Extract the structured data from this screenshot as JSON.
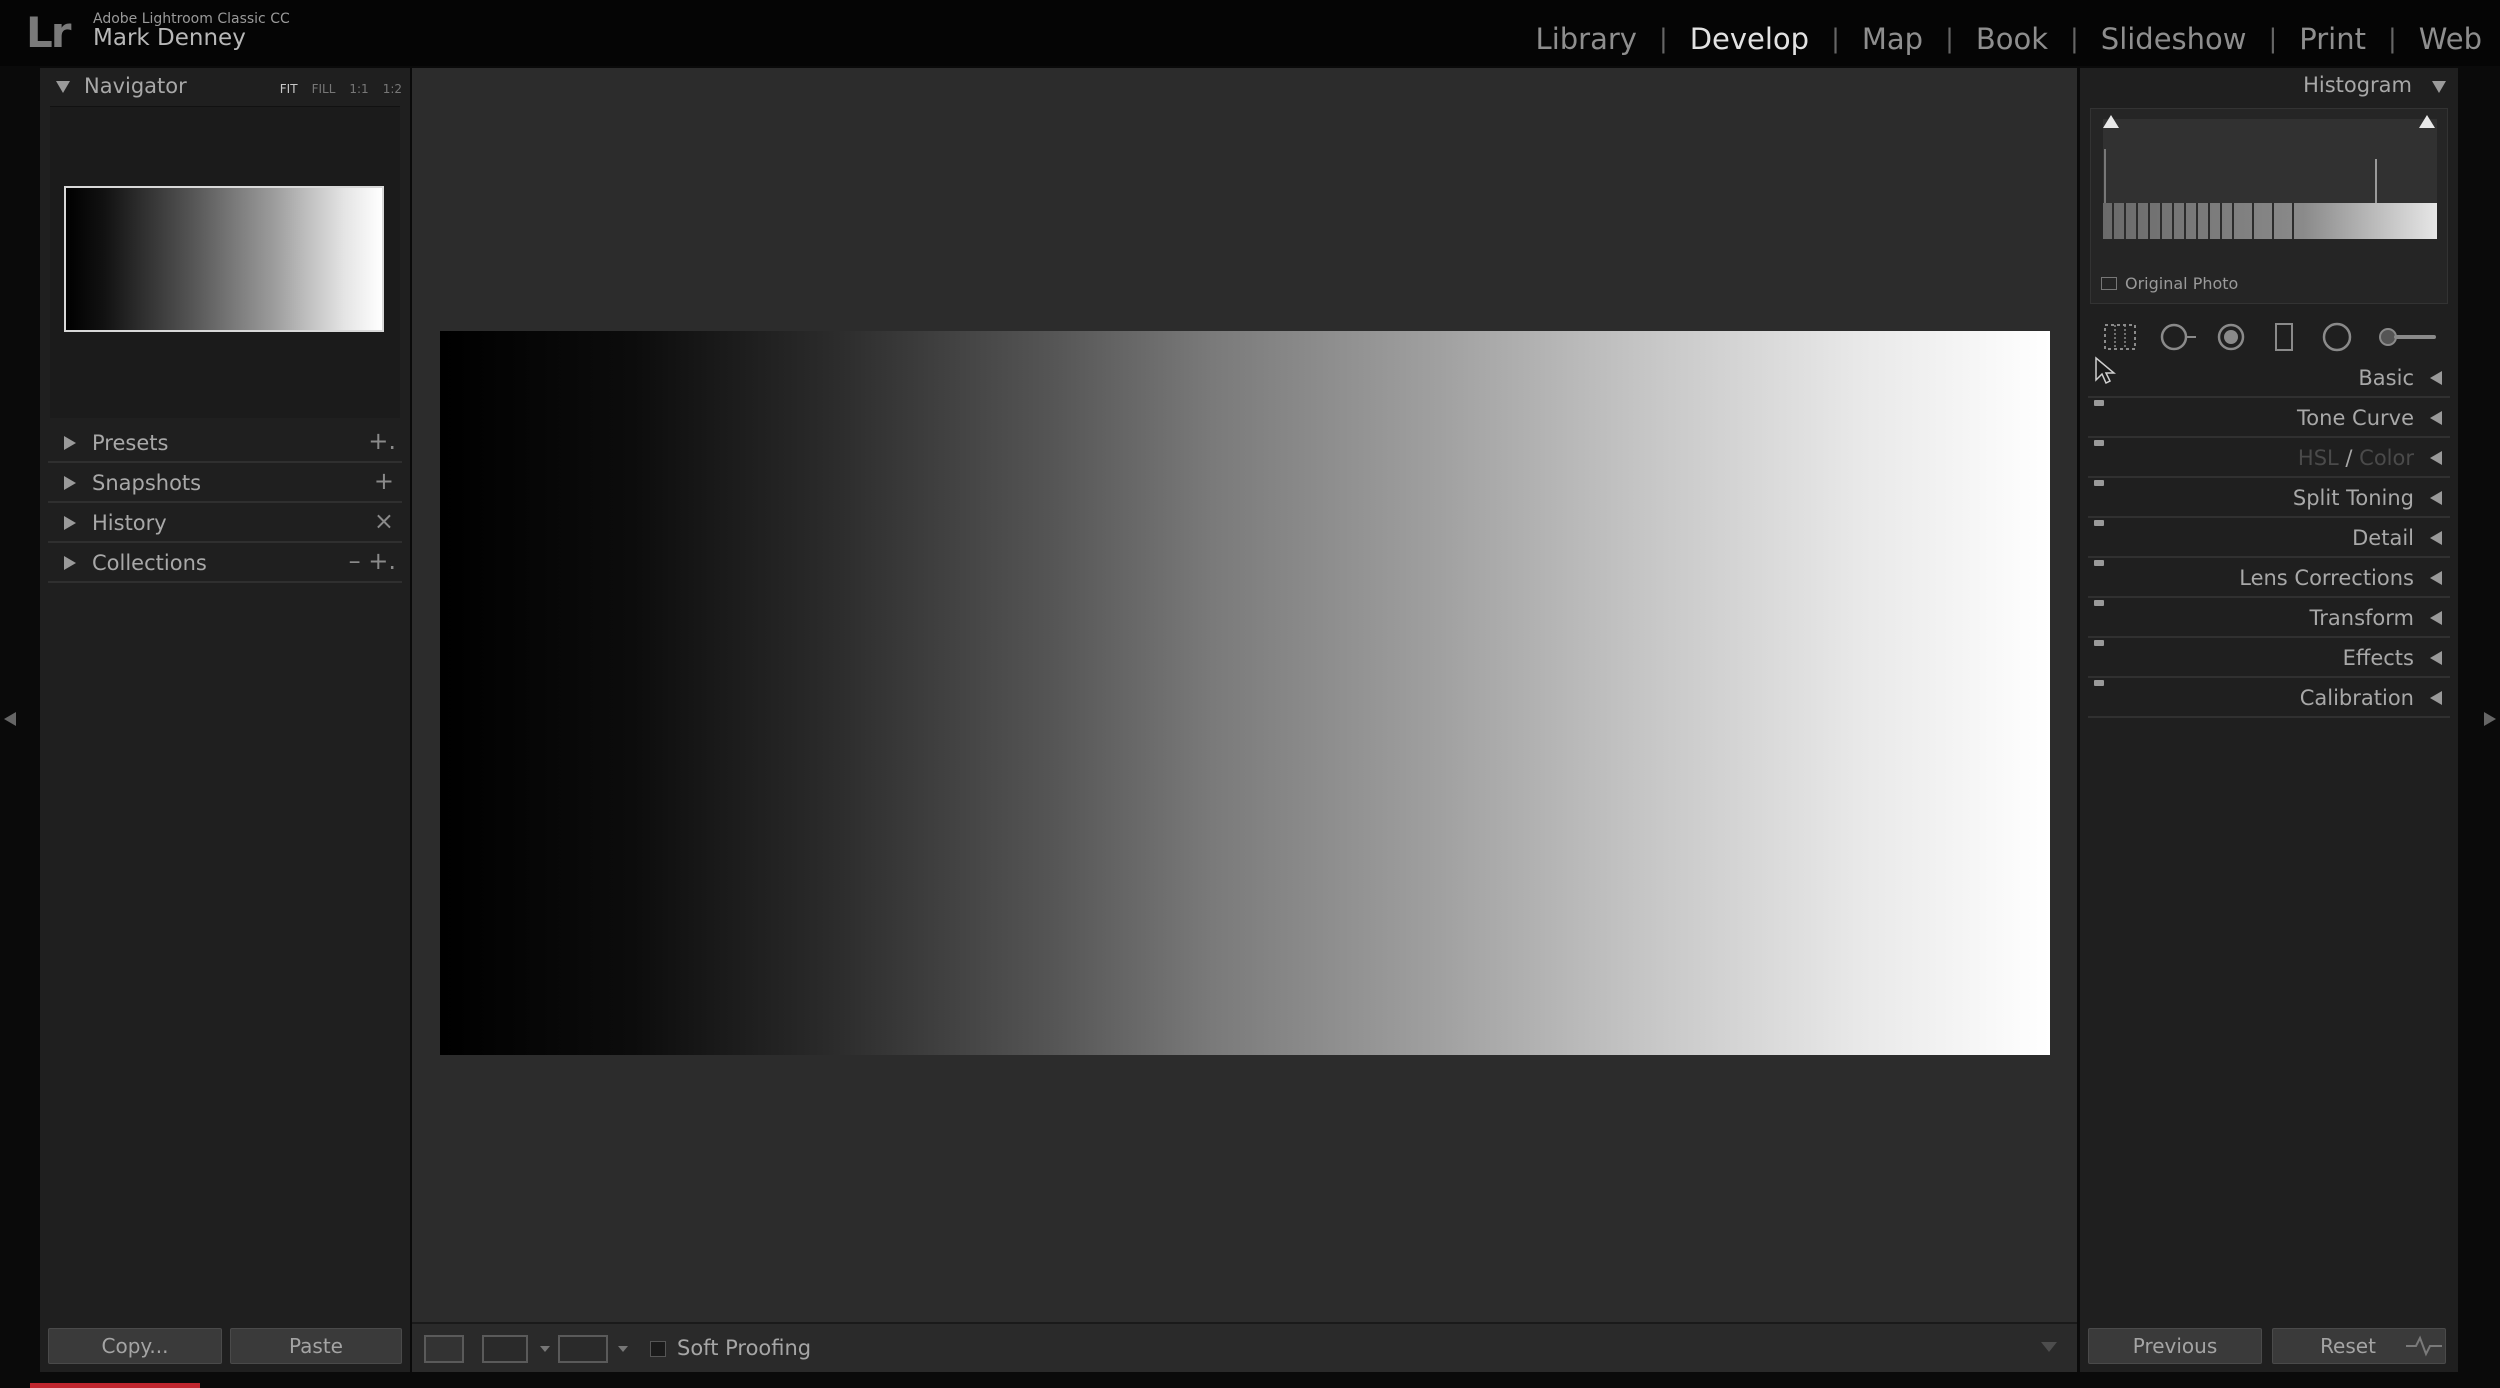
{
  "app": {
    "logo": "Lr",
    "name": "Adobe Lightroom Classic CC",
    "user": "Mark Denney"
  },
  "modules": [
    {
      "label": "Library",
      "active": false
    },
    {
      "label": "Develop",
      "active": true
    },
    {
      "label": "Map",
      "active": false
    },
    {
      "label": "Book",
      "active": false
    },
    {
      "label": "Slideshow",
      "active": false
    },
    {
      "label": "Print",
      "active": false
    },
    {
      "label": "Web",
      "active": false
    }
  ],
  "left_panel": {
    "navigator": {
      "title": "Navigator",
      "zoom": [
        "FIT",
        "FILL",
        "1:1",
        "1:2"
      ],
      "selected_zoom": "FIT"
    },
    "panels": [
      {
        "label": "Presets",
        "controls": "+."
      },
      {
        "label": "Snapshots",
        "controls": "+"
      },
      {
        "label": "History",
        "controls": "×"
      },
      {
        "label": "Collections",
        "controls": "– +."
      }
    ],
    "buttons": {
      "copy": "Copy...",
      "paste": "Paste"
    }
  },
  "toolbar": {
    "soft_proofing": "Soft Proofing",
    "soft_proofing_checked": false
  },
  "right_panel": {
    "histogram": {
      "title": "Histogram",
      "original_photo": "Original Photo"
    },
    "tools": [
      "crop-overlay",
      "spot-removal",
      "red-eye",
      "graduated-filter",
      "radial-filter",
      "adjustment-brush"
    ],
    "panels": [
      {
        "label": "Basic"
      },
      {
        "label": "Tone Curve"
      },
      {
        "label_a": "HSL",
        "sep": " / ",
        "label_b": "Color"
      },
      {
        "label": "Split Toning"
      },
      {
        "label": "Detail"
      },
      {
        "label": "Lens Corrections"
      },
      {
        "label": "Transform"
      },
      {
        "label": "Effects"
      },
      {
        "label": "Calibration"
      }
    ],
    "buttons": {
      "previous": "Previous",
      "reset": "Reset"
    }
  }
}
